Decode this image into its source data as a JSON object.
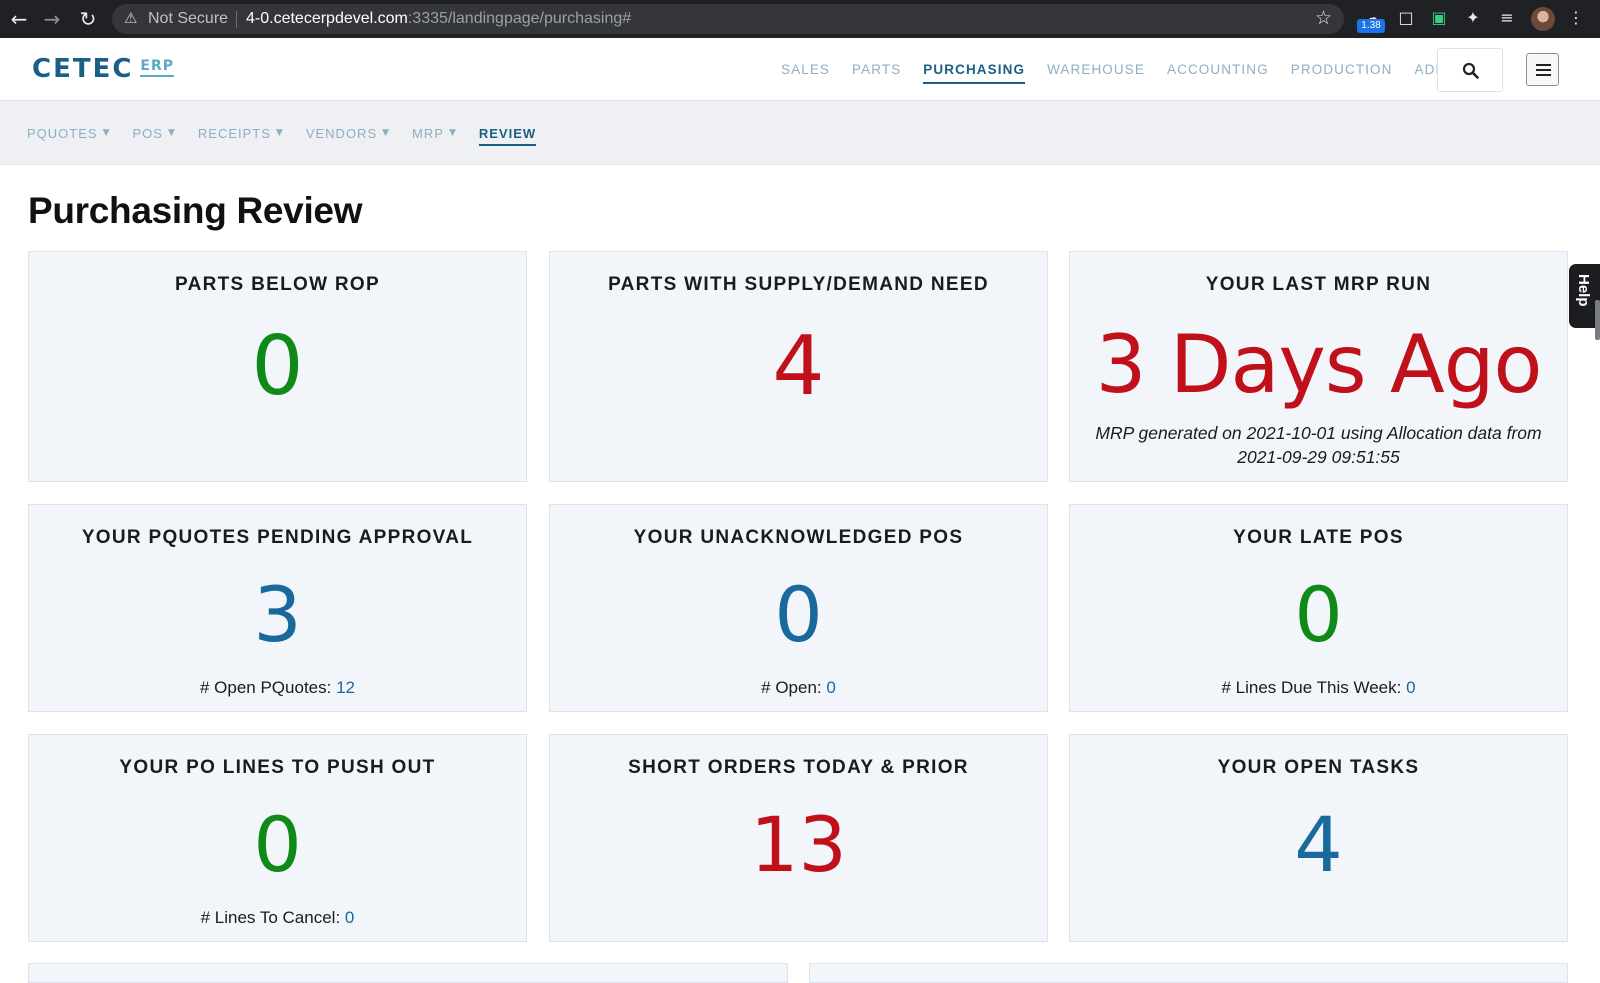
{
  "browser": {
    "not_secure": "Not Secure",
    "url_host": "4-0.cetecerpdevel.com",
    "url_rest": ":3335/landingpage/purchasing#",
    "extension_badge": "1.38"
  },
  "logo": {
    "main": "CETEC",
    "sub": "ERP"
  },
  "main_nav": [
    "SALES",
    "PARTS",
    "PURCHASING",
    "WAREHOUSE",
    "ACCOUNTING",
    "PRODUCTION",
    "ADMIN"
  ],
  "main_nav_active": "PURCHASING",
  "sub_nav": [
    "PQUOTES",
    "POS",
    "RECEIPTS",
    "VENDORS",
    "MRP",
    "REVIEW"
  ],
  "sub_nav_active": "REVIEW",
  "page_title": "Purchasing Review",
  "cards": {
    "parts_below_rop": {
      "title": "PARTS BELOW ROP",
      "value": "0"
    },
    "supply_demand": {
      "title": "PARTS WITH SUPPLY/DEMAND NEED",
      "value": "4"
    },
    "last_mrp": {
      "title": "YOUR LAST MRP RUN",
      "value": "3 Days Ago",
      "note": "MRP generated on 2021-10-01 using Allocation data from 2021-09-29 09:51:55"
    },
    "pquotes_pending": {
      "title": "YOUR PQUOTES PENDING APPROVAL",
      "value": "3",
      "foot_label": "# Open PQuotes:",
      "foot_value": "12"
    },
    "unacknowledged_pos": {
      "title": "YOUR UNACKNOWLEDGED POS",
      "value": "0",
      "foot_label": "# Open:",
      "foot_value": "0"
    },
    "late_pos": {
      "title": "YOUR LATE POS",
      "value": "0",
      "foot_label": "# Lines Due This Week:",
      "foot_value": "0"
    },
    "push_out": {
      "title": "YOUR PO LINES TO PUSH OUT",
      "value": "0",
      "foot_label": "# Lines To Cancel:",
      "foot_value": "0"
    },
    "short_orders": {
      "title": "SHORT ORDERS TODAY & PRIOR",
      "value": "13"
    },
    "open_tasks": {
      "title": "YOUR OPEN TASKS",
      "value": "4"
    }
  },
  "help_tab": "Help",
  "colors": {
    "brand": "#1a5f86",
    "good": "#0f8a16",
    "bad": "#c0101a",
    "neutral": "#19699c",
    "card_bg": "#f2f6fa"
  }
}
